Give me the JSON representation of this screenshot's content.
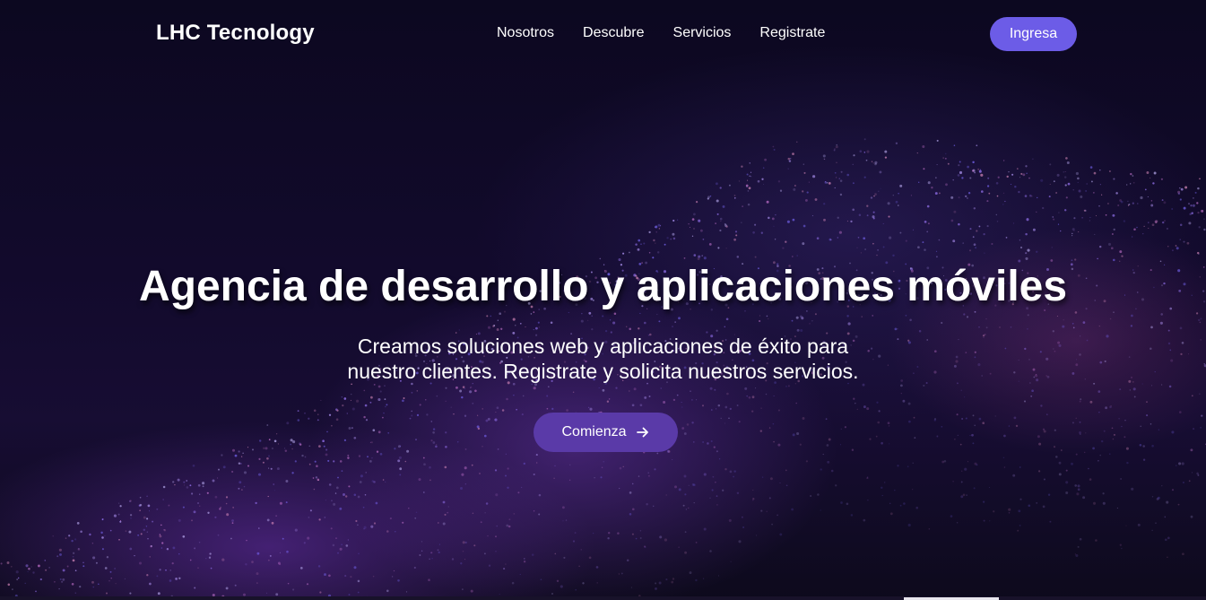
{
  "brand": {
    "name": "LHC Tecnology"
  },
  "nav": {
    "links": [
      {
        "label": "Nosotros"
      },
      {
        "label": "Descubre"
      },
      {
        "label": "Servicios"
      },
      {
        "label": "Registrate"
      }
    ],
    "login_label": "Ingresa"
  },
  "hero": {
    "title": "Agencia de desarrollo y aplicaciones móviles",
    "subtitle": "Creamos soluciones web y aplicaciones de éxito para nuestro clientes. Registrate y solicita nuestros servicios.",
    "cta_label": "Comienza",
    "cta_icon": "arrow-right-icon"
  },
  "colors": {
    "accent": "#6c5ce7",
    "cta": "#5a3aa8",
    "background": "#0c0820"
  }
}
